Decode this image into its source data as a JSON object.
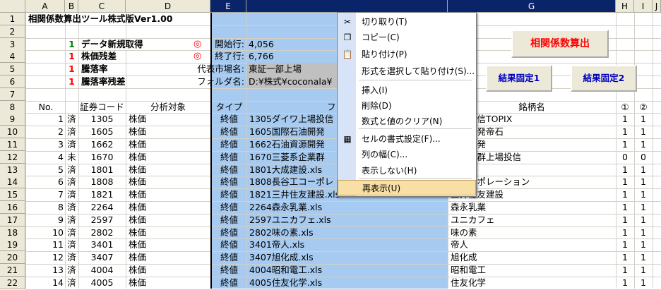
{
  "columns": [
    "A",
    "B",
    "C",
    "D",
    "E",
    "",
    "G",
    "H",
    "I",
    "J"
  ],
  "rows": [
    "1",
    "2",
    "3",
    "4",
    "5",
    "6",
    "7",
    "8",
    "9",
    "10",
    "11",
    "12",
    "13",
    "14",
    "15",
    "16",
    "17",
    "18",
    "19",
    "20",
    "21",
    "22"
  ],
  "title": "相関係数算出ツール株式版Ver1.00",
  "options": [
    {
      "num": "1",
      "label": "データ新規取得",
      "num_color": "green",
      "info": "開始行:",
      "value": "4,056"
    },
    {
      "num": "1",
      "label": "株価残差",
      "num_color": "red",
      "info": "終了行:",
      "value": "6,766"
    },
    {
      "num": "1",
      "label": "騰落率",
      "num_color": "red",
      "info": "代表市場名:",
      "value": "東証一部上場"
    },
    {
      "num": "1",
      "label": "騰落率残差",
      "num_color": "red",
      "info": "フォルダ名:",
      "value": "D:¥株式¥coconala¥"
    }
  ],
  "circle_mark": "◎",
  "headers": {
    "no": "No.",
    "code": "証券コード",
    "target": "分析対象",
    "type": "タイプ",
    "file": "ファ",
    "name": "銘柄名",
    "c1": "①",
    "c2": "②"
  },
  "table": [
    {
      "no": "1",
      "st": "済",
      "code": "1305",
      "target": "株価",
      "type": "終値",
      "file": "1305ダイワ上場投信",
      "name": "上場投信TOPIX",
      "c1": "1",
      "c2": "1"
    },
    {
      "no": "2",
      "st": "済",
      "code": "1605",
      "target": "株価",
      "type": "終値",
      "file": "1605国際石油開発",
      "name": "石油開発帝石",
      "c1": "1",
      "c2": "1"
    },
    {
      "no": "3",
      "st": "済",
      "code": "1662",
      "target": "株価",
      "type": "終値",
      "file": "1662石油資源開発",
      "name": "資源開発",
      "c1": "1",
      "c2": "1"
    },
    {
      "no": "4",
      "st": "未",
      "code": "1670",
      "target": "株価",
      "type": "終値",
      "file": "1670三菱系企業群",
      "name": "系企業群上場投信",
      "c1": "0",
      "c2": "0"
    },
    {
      "no": "5",
      "st": "済",
      "code": "1801",
      "target": "株価",
      "type": "終値",
      "file": "1801大成建設.xls",
      "name": "建設",
      "c1": "1",
      "c2": "1"
    },
    {
      "no": "6",
      "st": "済",
      "code": "1808",
      "target": "株価",
      "type": "終値",
      "file": "1808長谷工コーポレ",
      "name": "エコーポレーション",
      "c1": "1",
      "c2": "1"
    },
    {
      "no": "7",
      "st": "済",
      "code": "1821",
      "target": "株価",
      "type": "終値",
      "file": "1821三井住友建設.xls",
      "name": "三井住友建設",
      "c1": "1",
      "c2": "1"
    },
    {
      "no": "8",
      "st": "済",
      "code": "2264",
      "target": "株価",
      "type": "終値",
      "file": "2264森永乳業.xls",
      "name": "森永乳業",
      "c1": "1",
      "c2": "1"
    },
    {
      "no": "9",
      "st": "済",
      "code": "2597",
      "target": "株価",
      "type": "終値",
      "file": "2597ユニカフェ.xls",
      "name": "ユニカフェ",
      "c1": "1",
      "c2": "1"
    },
    {
      "no": "10",
      "st": "済",
      "code": "2802",
      "target": "株価",
      "type": "終値",
      "file": "2802味の素.xls",
      "name": "味の素",
      "c1": "1",
      "c2": "1"
    },
    {
      "no": "11",
      "st": "済",
      "code": "3401",
      "target": "株価",
      "type": "終値",
      "file": "3401帝人.xls",
      "name": "帝人",
      "c1": "1",
      "c2": "1"
    },
    {
      "no": "12",
      "st": "済",
      "code": "3407",
      "target": "株価",
      "type": "終値",
      "file": "3407旭化成.xls",
      "name": "旭化成",
      "c1": "1",
      "c2": "1"
    },
    {
      "no": "13",
      "st": "済",
      "code": "4004",
      "target": "株価",
      "type": "終値",
      "file": "4004昭和電工.xls",
      "name": "昭和電工",
      "c1": "1",
      "c2": "1"
    },
    {
      "no": "14",
      "st": "済",
      "code": "4005",
      "target": "株価",
      "type": "終値",
      "file": "4005住友化学.xls",
      "name": "住友化学",
      "c1": "1",
      "c2": "1"
    }
  ],
  "buttons": {
    "calc": "相関係数算出",
    "fix1": "結果固定1",
    "fix2": "結果固定2"
  },
  "menu": [
    {
      "label": "切り取り(T)",
      "icon": "scissors-icon",
      "glyph": "✂"
    },
    {
      "label": "コピー(C)",
      "icon": "copy-icon",
      "glyph": "❐"
    },
    {
      "label": "貼り付け(P)",
      "icon": "paste-icon",
      "glyph": "📋"
    },
    {
      "label": "形式を選択して貼り付け(S)...",
      "icon": "",
      "glyph": ""
    },
    {
      "label": "挿入(I)",
      "icon": "",
      "glyph": ""
    },
    {
      "label": "削除(D)",
      "icon": "",
      "glyph": ""
    },
    {
      "label": "数式と値のクリア(N)",
      "icon": "",
      "glyph": ""
    },
    {
      "label": "セルの書式設定(F)...",
      "icon": "format-cells-icon",
      "glyph": "▦"
    },
    {
      "label": "列の幅(C)...",
      "icon": "",
      "glyph": ""
    },
    {
      "label": "表示しない(H)",
      "icon": "",
      "glyph": ""
    },
    {
      "label": "再表示(U)",
      "icon": "",
      "glyph": ""
    }
  ]
}
